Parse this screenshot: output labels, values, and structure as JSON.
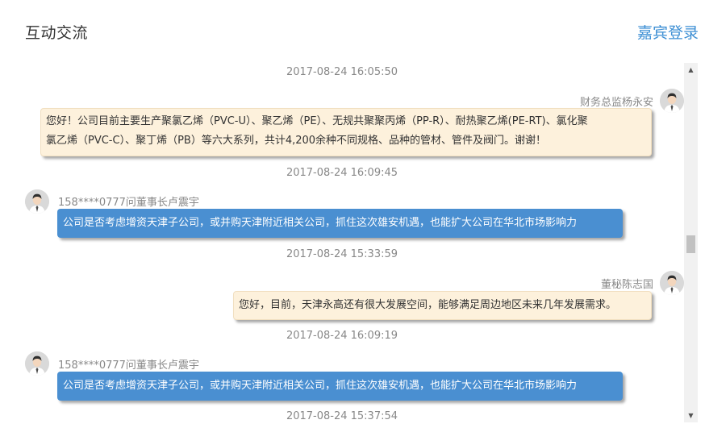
{
  "header": {
    "title": "互动交流",
    "login_label": "嘉宾登录"
  },
  "messages": [
    {
      "timestamp": "2017-08-24 16:05:50",
      "speaker": "财务总监杨永安",
      "type": "answer",
      "text_line1": "您好！公司目前主要生产聚氯乙烯（PVC-U）、聚乙烯（PE）、无规共聚聚丙烯（PP-R）、耐热聚乙烯(PE-RT)、氯化聚",
      "text_line2": "氯乙烯（PVC-C）、聚丁烯（PB）等六大系列，共计4,200余种不同规格、品种的管材、管件及阀门。谢谢！"
    },
    {
      "timestamp": "2017-08-24 16:09:45",
      "speaker": "158****0777问董事长卢震宇",
      "type": "question",
      "text": "公司是否考虑增资天津子公司，或并购天津附近相关公司，抓住这次雄安机遇，也能扩大公司在华北市场影响力"
    },
    {
      "timestamp": "2017-08-24 15:33:59",
      "speaker": "董秘陈志国",
      "type": "answer",
      "text": "您好，目前，天津永高还有很大发展空间，能够满足周边地区未来几年发展需求。"
    },
    {
      "timestamp": "2017-08-24 16:09:19",
      "speaker": "158****0777问董事长卢震宇",
      "type": "question",
      "text": "公司是否考虑增资天津子公司，或并购天津附近相关公司，抓住这次雄安机遇，也能扩大公司在华北市场影响力"
    },
    {
      "timestamp": "2017-08-24 15:37:54"
    }
  ],
  "colors": {
    "accent": "#3d8fd4",
    "question_bubble": "#4a8fd1",
    "answer_bubble": "#fdf1dc"
  },
  "icons": {
    "avatar": "user-avatar-icon",
    "scroll_up": "triangle-up-icon",
    "scroll_down": "triangle-down-icon"
  }
}
